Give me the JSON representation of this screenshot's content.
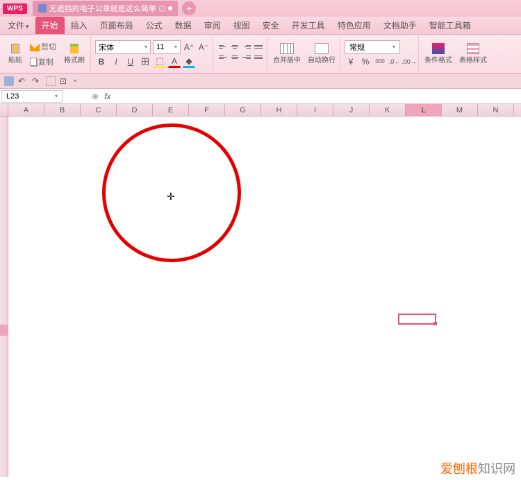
{
  "title_bar": {
    "app_name": "WPS",
    "doc_title": "无遮挡的电子公章就是这么简单",
    "tab_indicator": "●"
  },
  "menu": {
    "file": "文件",
    "start": "开始",
    "insert": "插入",
    "page_layout": "页面布局",
    "formula": "公式",
    "data": "数据",
    "review": "审阅",
    "view": "视图",
    "security": "安全",
    "dev": "开发工具",
    "special": "特色应用",
    "doc_helper": "文档助手",
    "toolbox": "智能工具箱"
  },
  "ribbon": {
    "cut": "剪切",
    "copy": "复制",
    "paste": "粘贴",
    "format_painter": "格式刷",
    "font_name": "宋体",
    "font_size": "11",
    "bold": "B",
    "italic": "I",
    "underline": "U",
    "border": "田",
    "merge_center": "合并居中",
    "auto_wrap": "自动换行",
    "number_format": "常规",
    "percent": "%",
    "comma": "000",
    "cond_format": "条件格式",
    "table_style": "表格样式",
    "increase_font": "A⁺",
    "decrease_font": "A⁻"
  },
  "name_box": {
    "value": "L23"
  },
  "fx": {
    "label": "fx"
  },
  "columns": [
    "A",
    "B",
    "C",
    "D",
    "E",
    "F",
    "G",
    "H",
    "I",
    "J",
    "K",
    "L",
    "M",
    "N"
  ],
  "active_col": "L",
  "watermark": {
    "part1": "爱刨根",
    "part2": "知识网"
  }
}
